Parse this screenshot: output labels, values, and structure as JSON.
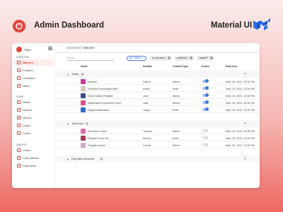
{
  "header": {
    "title": "Admin Dashboard",
    "right_label": "Material UI"
  },
  "app": {
    "name": "Yoyo"
  },
  "breadcrumb": {
    "root": "Dashboard",
    "separator": "/",
    "current": "Banners"
  },
  "sidebar": {
    "sections": [
      {
        "label": "CURATOR",
        "items": [
          {
            "label": "Banners",
            "active": true
          },
          {
            "label": "Features"
          },
          {
            "label": "Collections"
          },
          {
            "label": "Mixes"
          }
        ]
      },
      {
        "label": "CORE",
        "items": [
          {
            "label": "Artists"
          },
          {
            "label": "Albums"
          },
          {
            "label": "Genres"
          },
          {
            "label": "Labels"
          },
          {
            "label": "Tracks"
          }
        ]
      },
      {
        "label": "CHARTS",
        "items": [
          {
            "label": "Charts"
          },
          {
            "label": "Chart editions"
          },
          {
            "label": "Chart items"
          }
        ]
      }
    ]
  },
  "toolbar": {
    "search_placeholder": "Search",
    "filters_label": "Filters",
    "chips": [
      "is_new:abcs",
      "published",
      "basketT"
    ]
  },
  "table": {
    "columns": [
      "Name",
      "Subtitle",
      "Content type",
      "Active",
      "Start time"
    ],
    "groups": [
      {
        "name": "Today",
        "count": "5",
        "expanded": true,
        "rows": [
          {
            "name": "Innopho",
            "subtitle": "Dianne",
            "type": "Album",
            "active": true,
            "start": "Sept. 20, 2021, 12:30 PM",
            "thumb": "#c9389a"
          },
          {
            "name": "Parturient Venenatis Etiam",
            "subtitle": "Kristin",
            "type": "Artist",
            "active": true,
            "start": "Sept. 20, 2021, 12:30 PM",
            "thumb": "#d8c7c0"
          },
          {
            "name": "Tortor Nullam Fringilla",
            "subtitle": "Jane",
            "type": "Album",
            "active": true,
            "start": "Sept. 20, 2021, 12:30 PM",
            "thumb": "#3b4a8f"
          },
          {
            "name": "Malesuada Fermentum Tortor",
            "subtitle": "Julia",
            "type": "Album",
            "active": true,
            "start": "Sept. 20, 2021, 12:30 PM",
            "thumb": "#e04d8a"
          },
          {
            "name": "Magna Malesuada",
            "subtitle": "Tanya",
            "type": "Artist",
            "active": true,
            "start": "Sept. 20, 2021, 12:30 PM",
            "thumb": "#2e6fd1"
          }
        ]
      },
      {
        "name": "Tomorrow",
        "count": "3",
        "expanded": true,
        "rows": [
          {
            "name": "Parturient Lorem",
            "subtitle": "Theresa",
            "type": "Album",
            "active": false,
            "start": "Sept. 20, 2021, 12:30 PM",
            "thumb": "#e46aa6"
          },
          {
            "name": "Fringilla Fusce Elit",
            "subtitle": "Aubrey",
            "type": "Artist",
            "active": false,
            "start": "Sept. 20, 2021, 12:30 PM",
            "thumb": "#b2355e"
          },
          {
            "name": "Fringilla Nullam",
            "subtitle": "Connie",
            "type": "Album",
            "active": false,
            "start": "Sept. 20, 2021, 12:30 PM",
            "thumb": "#d9a2c6"
          }
        ]
      },
      {
        "name": "Day after tomorrow",
        "count": "8",
        "expanded": false,
        "rows": []
      }
    ]
  },
  "colors": {
    "brand": "#e8423b",
    "accent": "#3f75e8",
    "active_nav_bg": "#fdeceb"
  }
}
